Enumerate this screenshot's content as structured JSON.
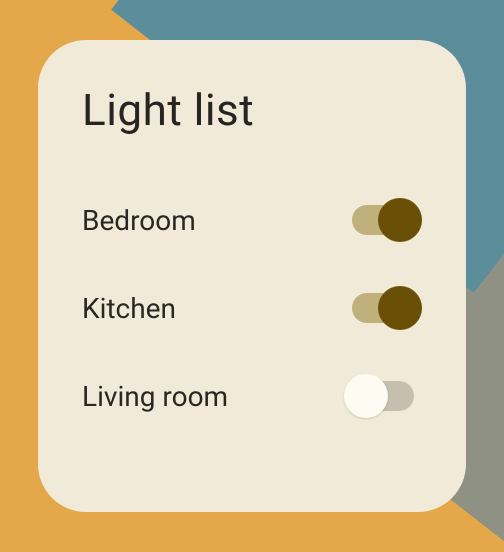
{
  "card": {
    "title": "Light list",
    "rooms": [
      {
        "label": "Bedroom",
        "on": true
      },
      {
        "label": "Kitchen",
        "on": true
      },
      {
        "label": "Living room",
        "on": false
      }
    ]
  },
  "colors": {
    "card_bg": "#f2ead9",
    "thumb_on": "#6a5006",
    "track_on": "#bfb07c",
    "thumb_off": "#fefbf3",
    "track_off": "#c6beae"
  }
}
